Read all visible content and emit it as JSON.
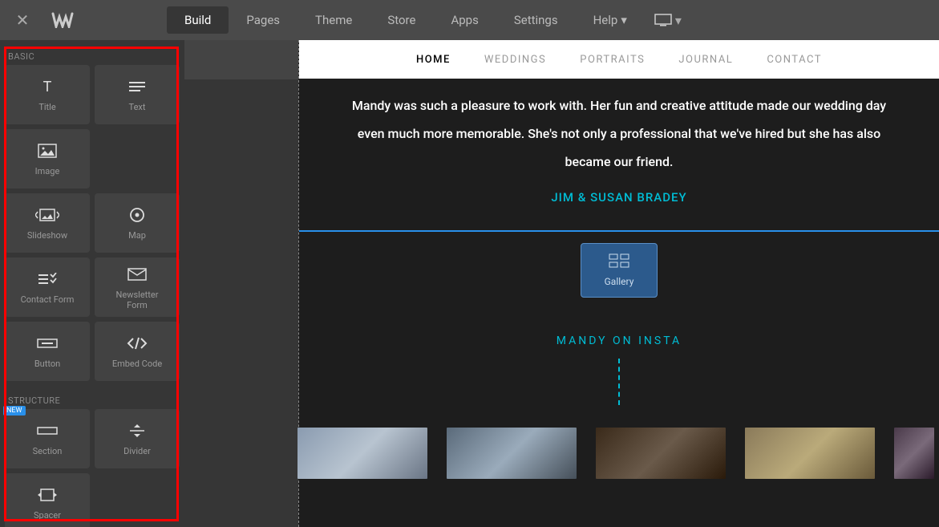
{
  "topnav": {
    "items": [
      "Build",
      "Pages",
      "Theme",
      "Store",
      "Apps",
      "Settings",
      "Help"
    ],
    "active_index": 0
  },
  "sidebar": {
    "sections": [
      {
        "label": "BASIC",
        "tiles": [
          {
            "name": "title",
            "label": "Title",
            "icon": "title"
          },
          {
            "name": "text",
            "label": "Text",
            "icon": "text"
          },
          {
            "name": "image",
            "label": "Image",
            "icon": "image"
          },
          {
            "name": "slideshow",
            "label": "Slideshow",
            "icon": "slideshow"
          },
          {
            "name": "map",
            "label": "Map",
            "icon": "map"
          },
          {
            "name": "contact-form",
            "label": "Contact Form",
            "icon": "contact-form"
          },
          {
            "name": "newsletter-form",
            "label": "Newsletter\nForm",
            "icon": "newsletter"
          },
          {
            "name": "button",
            "label": "Button",
            "icon": "button"
          },
          {
            "name": "embed-code",
            "label": "Embed Code",
            "icon": "code"
          }
        ]
      },
      {
        "label": "STRUCTURE",
        "tiles": [
          {
            "name": "section",
            "label": "Section",
            "icon": "section",
            "badge": "NEW"
          },
          {
            "name": "divider",
            "label": "Divider",
            "icon": "divider"
          },
          {
            "name": "spacer",
            "label": "Spacer",
            "icon": "spacer"
          }
        ]
      }
    ]
  },
  "preview": {
    "nav": [
      "HOME",
      "WEDDINGS",
      "PORTRAITS",
      "JOURNAL",
      "CONTACT"
    ],
    "nav_active": 0,
    "testimonial": "Mandy was such a pleasure to work with. Her fun and creative attitude made our wedding day even much more memorable. She's not only a professional that we've hired but she has also became our friend.",
    "testimonial_name": "JIM & SUSAN BRADEY",
    "gallery_label": "Gallery",
    "insta_heading": "MANDY ON INSTA"
  },
  "colors": {
    "accent": "#00bcd4",
    "editor_blue": "#2990ea"
  }
}
